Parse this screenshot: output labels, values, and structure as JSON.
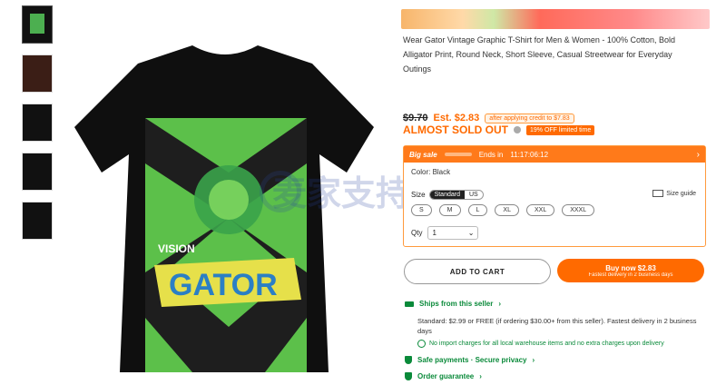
{
  "gallery": {
    "thumb_count": 5
  },
  "product": {
    "title_visible": "Wear Gator Vintage Graphic T-Shirt for Men & Women - 100% Cotton, Bold Alligator Print, Round Neck, Short Sleeve, Casual Streetwear for Everyday Outings",
    "shirt_graphic_top": "VISION",
    "shirt_graphic_main": "GATOR"
  },
  "pricing": {
    "old_price": "$9.70",
    "est_price": "Est. $2.83",
    "coupon_note": "after applying credit to $7.83",
    "stock_status": "ALMOST SOLD OUT",
    "discount_badge": "19% OFF limited time"
  },
  "sale_panel": {
    "label": "Big sale",
    "ends_in": "Ends in",
    "timer": "11:17:06:12",
    "color_label": "Color: Black",
    "size_label": "Size",
    "size_toggle_on": "Standard",
    "size_toggle_off": "US",
    "size_guide": "Size guide",
    "sizes": [
      "S",
      "M",
      "L",
      "XL",
      "XXL",
      "XXXL"
    ],
    "qty_label": "Qty",
    "qty_value": "1"
  },
  "actions": {
    "add_to_cart": "ADD TO CART",
    "buy_now": "Buy now $2.83",
    "buy_now_sub": "Fastest delivery in 2 business days"
  },
  "shipping": {
    "heading": "Ships from this seller",
    "text": "Standard: $2.99 or FREE (if ordering $30.00+ from this seller). Fastest delivery in 2 business days",
    "note": "No import charges for all local warehouse items and no extra charges upon delivery",
    "safe": "Safe payments · Secure privacy",
    "guarantee": "Order guarantee"
  },
  "watermark": {
    "text": "麦家支持"
  },
  "colors": {
    "accent": "#ff6a00",
    "green": "#0a8a3a",
    "shirt": "#111111",
    "graphic_green": "#5cc04a",
    "graphic_yellow": "#e6e04a"
  }
}
